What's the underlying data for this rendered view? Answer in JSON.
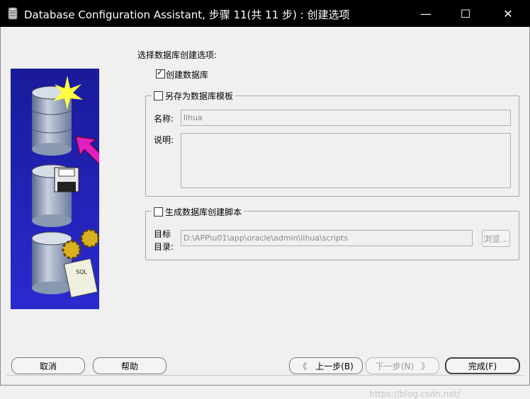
{
  "window": {
    "title": "Database Configuration Assistant, 步骤 11(共 11 步) : 创建选项",
    "minimize_label": "—",
    "maximize_label": "☐",
    "close_label": "✕"
  },
  "main": {
    "heading": "选择数据库创建选项:",
    "create_db": {
      "label": "创建数据库",
      "checked": true
    },
    "template_group": {
      "checkbox_label": "另存为数据库模板",
      "checked": false,
      "name_label": "名称:",
      "name_value": "lihua",
      "desc_label": "说明:"
    },
    "script_group": {
      "checkbox_label": "生成数据库创建脚本",
      "checked": false,
      "dir_label_line1": "目标",
      "dir_label_line2": "目录:",
      "dir_value": "D:\\APP\\u01\\app\\oracle\\admin\\lihua\\scripts",
      "browse_label": "浏览..."
    }
  },
  "footer": {
    "cancel_label": "取消",
    "help_label": "帮助",
    "back_label": "上一步(B)",
    "next_label": "下一步(N)",
    "finish_label": "完成(F)"
  },
  "watermark": "https://blog.csdn.net/",
  "icons": [
    "database-app-icon",
    "database-new-icon",
    "database-save-icon",
    "database-script-icon"
  ],
  "colors": {
    "titlebar": "#000000",
    "panel_bg": "#1a1a8c",
    "arrow": "#e020c0"
  }
}
